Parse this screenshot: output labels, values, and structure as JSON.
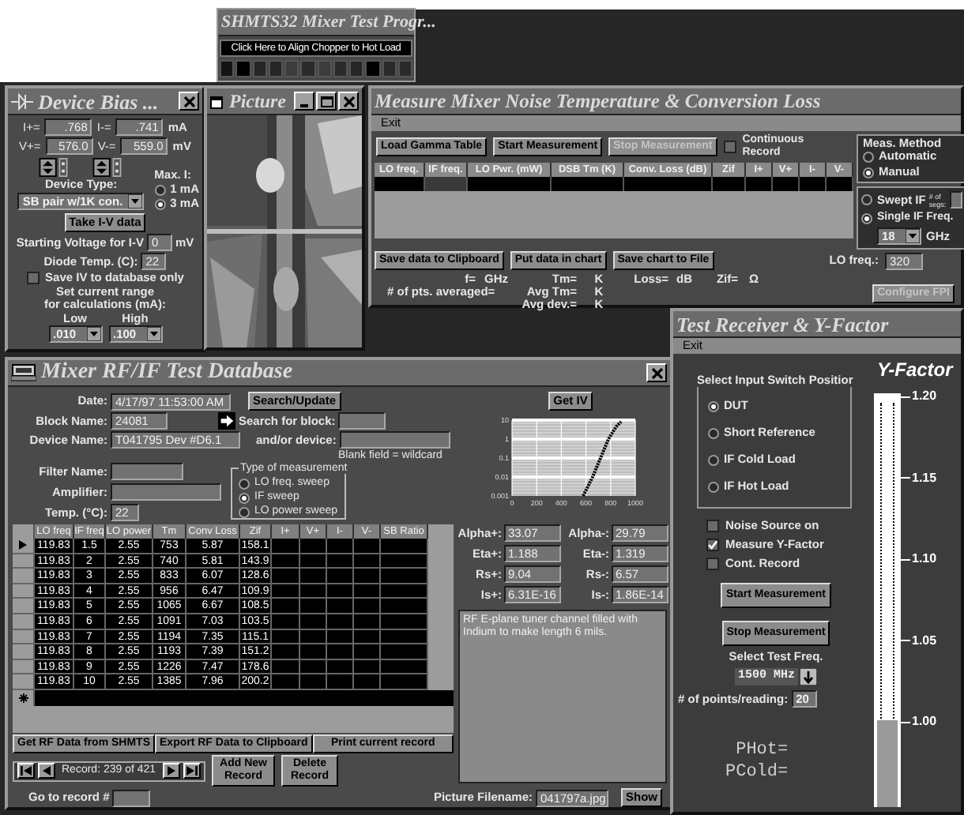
{
  "main_window": {
    "title": "SHMTS32 Mixer Test Progr...",
    "align_button": "Click Here to Align Chopper to Hot Load",
    "indicators": [
      {
        "color": "#141414"
      },
      {
        "color": "#000000"
      },
      {
        "color": "#262626"
      },
      {
        "color": "#262626"
      },
      {
        "color": "#3c3c3c"
      },
      {
        "color": "#2a2a2a"
      },
      {
        "color": "#3c3c3c"
      },
      {
        "color": "#2a2a2a"
      },
      {
        "color": "#262626"
      },
      {
        "color": "#000000"
      },
      {
        "color": "#2a2a2a"
      },
      {
        "color": "#2a2a2a"
      }
    ]
  },
  "device_bias": {
    "title": "Device Bias ...",
    "currents": [
      {
        "label": "I+=",
        "value": ".768"
      },
      {
        "label": "I-=",
        "value": ".741"
      }
    ],
    "current_unit": "mA",
    "voltages": [
      {
        "label": "V+=",
        "value": "576.0"
      },
      {
        "label": "V-=",
        "value": "559.0"
      }
    ],
    "voltage_unit": "mV",
    "max_current": {
      "label": "Max. I:",
      "options": [
        {
          "label": "1 mA",
          "selected": false
        },
        {
          "label": "3 mA",
          "selected": true
        }
      ]
    },
    "device_type": {
      "label": "Device Type:",
      "value": "SB pair w/1K con."
    },
    "take_iv_button": "Take I-V data",
    "starting_voltage": {
      "label": "Starting Voltage for I-V",
      "value": "0",
      "unit": "mV"
    },
    "diode_temp": {
      "label": "Diode Temp. (C):",
      "value": "22"
    },
    "save_iv_only": {
      "label": "Save IV to database only",
      "checked": false
    },
    "range_caption": "Set current range\nfor calculations (mA):",
    "range_low": {
      "label": "Low",
      "value": ".010"
    },
    "range_high": {
      "label": "High",
      "value": ".100"
    }
  },
  "picture_window": {
    "title": "Picture"
  },
  "measure_window": {
    "title": "Measure Mixer Noise Temperature & Conversion Loss",
    "menu": [
      "Exit"
    ],
    "toolbar": [
      {
        "label": "Load Gamma Table",
        "disabled": false
      },
      {
        "label": "Start Measurement",
        "disabled": false
      },
      {
        "label": "Stop Measurement",
        "disabled": true
      }
    ],
    "continuous_record": {
      "label": "Continuous Record",
      "checked": false
    },
    "table": {
      "columns": [
        "LO freq.",
        "IF freq.",
        "LO Pwr. (mW)",
        "DSB Tm (K)",
        "Conv. Loss (dB)",
        "Zif",
        "I+",
        "V+",
        "I-",
        "V-"
      ]
    },
    "method": {
      "label": "Meas. Method",
      "options": [
        {
          "label": "Automatic",
          "selected": false
        },
        {
          "label": "Manual",
          "selected": true
        }
      ]
    },
    "if_mode": {
      "options": [
        {
          "label": "Swept IF",
          "selected": false
        },
        {
          "label": "Single IF Freq.",
          "selected": true
        }
      ],
      "segments_label": "# of segs:",
      "frequency": "18",
      "unit": "GHz"
    },
    "actions": [
      "Save data to Clipboard",
      "Put data in chart",
      "Save chart to File"
    ],
    "lo_freq": {
      "label": "LO freq.:",
      "value": "320"
    },
    "readouts": [
      {
        "label": "f=",
        "unit": "GHz"
      },
      {
        "label": "Tm=",
        "unit": "K"
      },
      {
        "label": "Loss=",
        "unit": "dB"
      },
      {
        "label": "Zif=",
        "unit": "Ω"
      }
    ],
    "averages": [
      {
        "label": "# of pts. averaged="
      },
      {
        "label": "Avg Tm=",
        "unit": "K"
      },
      {
        "label": "Avg dev.=",
        "unit": "K"
      }
    ],
    "configure_button": {
      "label": "Configure FPI",
      "disabled": true
    }
  },
  "database": {
    "title": "Mixer RF/IF Test Database",
    "date": {
      "label": "Date:",
      "value": "4/17/97 11:53:00 AM"
    },
    "search_button": "Search/Update",
    "get_iv_button": "Get IV",
    "block_name": {
      "label": "Block Name:",
      "value": "24081"
    },
    "search_block": {
      "label": "Search for block:"
    },
    "device_name": {
      "label": "Device Name:",
      "value": "T041795 Dev #D6.1"
    },
    "search_device": {
      "label": "and/or device:"
    },
    "wildcard_note": "Blank field = wildcard",
    "filter_name": {
      "label": "Filter Name:"
    },
    "amplifier": {
      "label": "Amplifier:"
    },
    "temperature": {
      "label": "Temp. (°C):",
      "value": "22"
    },
    "measurement_type": {
      "label": "Type of measurement",
      "options": [
        {
          "label": "LO freq. sweep",
          "selected": false
        },
        {
          "label": "IF sweep",
          "selected": true
        },
        {
          "label": "LO power sweep",
          "selected": false
        }
      ]
    },
    "iv_plot": {
      "x_ticks": [
        "0",
        "200",
        "400",
        "600",
        "800",
        "1000"
      ],
      "y_ticks": [
        "10",
        "1",
        "0.1",
        "0.01",
        "0.001"
      ]
    },
    "diode_params": [
      {
        "label": "Alpha+:",
        "value": "33.07"
      },
      {
        "label": "Alpha-:",
        "value": "29.79"
      },
      {
        "label": "Eta+:",
        "value": "1.188"
      },
      {
        "label": "Eta-:",
        "value": "1.319"
      },
      {
        "label": "Rs+:",
        "value": "9.04"
      },
      {
        "label": "Rs-:",
        "value": "6.57"
      },
      {
        "label": "Is+:",
        "value": "6.31E-16"
      },
      {
        "label": "Is-:",
        "value": "1.86E-14"
      }
    ],
    "notes": "RF E-plane tuner channel filled with Indium to make length 6 mils.",
    "table": {
      "columns": [
        "LO freq",
        "IF freq",
        "LO power",
        "Tm",
        "Conv Loss",
        "Zif",
        "I+",
        "V+",
        "I-",
        "V-",
        "SB Ratio"
      ],
      "rows": [
        {
          "cells": [
            "119.83",
            "1.5",
            "2.55",
            "753",
            "5.87",
            "158.1"
          ],
          "selected": true
        },
        {
          "cells": [
            "119.83",
            "2",
            "2.55",
            "740",
            "5.81",
            "143.9"
          ],
          "selected": false
        },
        {
          "cells": [
            "119.83",
            "3",
            "2.55",
            "833",
            "6.07",
            "128.6"
          ],
          "selected": false
        },
        {
          "cells": [
            "119.83",
            "4",
            "2.55",
            "956",
            "6.47",
            "109.9"
          ],
          "selected": false
        },
        {
          "cells": [
            "119.83",
            "5",
            "2.55",
            "1065",
            "6.67",
            "108.5"
          ],
          "selected": false
        },
        {
          "cells": [
            "119.83",
            "6",
            "2.55",
            "1091",
            "7.03",
            "103.5"
          ],
          "selected": false
        },
        {
          "cells": [
            "119.83",
            "7",
            "2.55",
            "1194",
            "7.35",
            "115.1"
          ],
          "selected": false
        },
        {
          "cells": [
            "119.83",
            "8",
            "2.55",
            "1193",
            "7.39",
            "151.2"
          ],
          "selected": false
        },
        {
          "cells": [
            "119.83",
            "9",
            "2.55",
            "1226",
            "7.47",
            "178.6"
          ],
          "selected": false
        },
        {
          "cells": [
            "119.83",
            "10",
            "2.55",
            "1385",
            "7.96",
            "200.2"
          ],
          "selected": false
        }
      ]
    },
    "buttons": [
      "Get RF Data from SHMTS",
      "Export RF Data to Clipboard",
      "Print current record"
    ],
    "record_nav": "Record: 239 of 421",
    "add_button": "Add New Record",
    "delete_button": "Delete Record",
    "goto": {
      "label": "Go to record #"
    },
    "picture_filename": {
      "label": "Picture Filename:",
      "value": "041797a.jpg"
    },
    "show_button": "Show"
  },
  "receiver": {
    "title": "Test Receiver & Y-Factor",
    "menu": [
      "Exit"
    ],
    "switch": {
      "label": "Select Input Switch Positior",
      "options": [
        {
          "label": "DUT",
          "selected": true
        },
        {
          "label": "Short Reference",
          "selected": false
        },
        {
          "label": "IF Cold Load",
          "selected": false
        },
        {
          "label": "IF Hot Load",
          "selected": false
        }
      ]
    },
    "checks": [
      {
        "label": "Noise Source on",
        "checked": false
      },
      {
        "label": "Measure Y-Factor",
        "checked": true
      },
      {
        "label": "Cont. Record",
        "checked": false
      }
    ],
    "start_button": "Start Measurement",
    "stop_button": "Stop Measurement",
    "test_freq": {
      "label": "Select Test Freq.",
      "value": "1500 MHz"
    },
    "points": {
      "label": "# of points/reading:",
      "value": "20"
    },
    "powers": [
      "PHot=",
      "PCold="
    ],
    "gauge": {
      "title": "Y-Factor",
      "ticks": [
        "1.20",
        "1.15",
        "1.10",
        "1.05",
        "1.00"
      ],
      "level": 0.21
    }
  }
}
